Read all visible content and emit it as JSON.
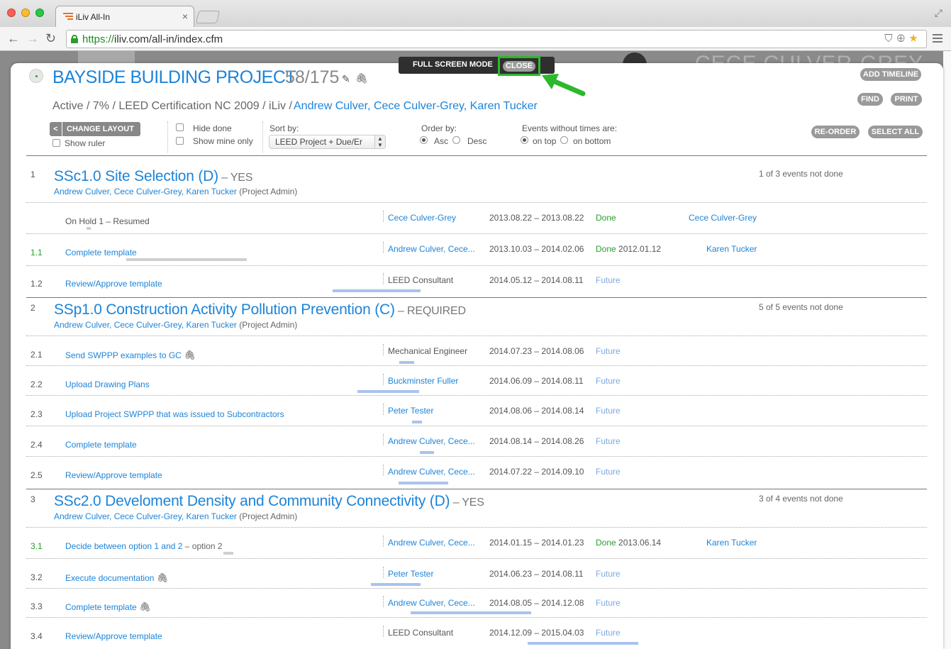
{
  "browser": {
    "tab_title": "iLiv All-In",
    "url_scheme": "https://",
    "url_host": "iliv.com",
    "url_path": "/all-in/index.cfm"
  },
  "background": {
    "header_text": "CECE CULVER-GREY"
  },
  "fullscreen": {
    "label": "FULL SCREEN MODE",
    "close_label": "CLOSE",
    "annotation_color": "#2db82d"
  },
  "project": {
    "title": "BAYSIDE BUILDING PROJECT",
    "count": "58/175",
    "status_line": "Active / 7% / LEED Certification NC 2009 / iLiv /",
    "people": "Andrew Culver, Cece Culver-Grey, Karen Tucker",
    "add_timeline": "ADD TIMELINE",
    "find": "FIND",
    "print": "PRINT"
  },
  "controls": {
    "change_layout_arrow": "<",
    "change_layout": "CHANGE LAYOUT",
    "show_ruler": "Show ruler",
    "hide_done": "Hide done",
    "show_mine_only": "Show mine only",
    "sort_by_label": "Sort by:",
    "sort_by_value": "LEED Project + Due/Er",
    "order_by_label": "Order by:",
    "asc": "Asc",
    "desc": "Desc",
    "events_label": "Events without times are:",
    "on_top": "on top",
    "on_bottom": "on bottom",
    "reorder": "RE-ORDER",
    "select_all": "SELECT ALL"
  },
  "sections": [
    {
      "num": "1",
      "title": "SSc1.0 Site Selection (D)",
      "suffix": " – YES",
      "people": "Andrew Culver, Cece Culver-Grey, Karen Tucker",
      "role": " (Project Admin)",
      "status": "1 of 3 events not done",
      "rows": [
        {
          "num": "",
          "name": "On Hold 1 – Resumed",
          "who": "Cece Culver-Grey",
          "dates": "2013.08.22 – 2013.08.22",
          "state": "Done",
          "done_date": "",
          "by": "Cece Culver-Grey"
        },
        {
          "num": "1.1",
          "name": "Complete template",
          "who": "Andrew Culver, Cece...",
          "dates": "2013.10.03 – 2014.02.06",
          "state": "Done",
          "done_date": " 2012.01.12",
          "by": "Karen Tucker"
        },
        {
          "num": "1.2",
          "name": "Review/Approve template",
          "who": "LEED Consultant",
          "dates": "2014.05.12 – 2014.08.11",
          "state": "Future",
          "done_date": "",
          "by": ""
        }
      ]
    },
    {
      "num": "2",
      "title": "SSp1.0 Construction Activity Pollution Prevention (C)",
      "suffix": " – REQUIRED",
      "people": "Andrew Culver, Cece Culver-Grey, Karen Tucker",
      "role": " (Project Admin)",
      "status": "5 of 5 events not done",
      "rows": [
        {
          "num": "2.1",
          "name": "Send SWPPP examples to GC",
          "who": "Mechanical Engineer",
          "dates": "2014.07.23 – 2014.08.06",
          "state": "Future"
        },
        {
          "num": "2.2",
          "name": "Upload Drawing Plans",
          "who": "Buckminster Fuller",
          "dates": "2014.06.09 – 2014.08.11",
          "state": "Future"
        },
        {
          "num": "2.3",
          "name": "Upload Project SWPPP that was issued to Subcontractors",
          "who": "Peter Tester",
          "dates": "2014.08.06 – 2014.08.14",
          "state": "Future"
        },
        {
          "num": "2.4",
          "name": "Complete template",
          "who": "Andrew Culver, Cece...",
          "dates": "2014.08.14 – 2014.08.26",
          "state": "Future"
        },
        {
          "num": "2.5",
          "name": "Review/Approve template",
          "who": "Andrew Culver, Cece...",
          "dates": "2014.07.22 – 2014.09.10",
          "state": "Future"
        }
      ]
    },
    {
      "num": "3",
      "title": "SSc2.0 Develoment Density and Community Connectivity (D)",
      "suffix": " – YES",
      "people": "Andrew Culver, Cece Culver-Grey, Karen Tucker",
      "role": " (Project Admin)",
      "status": "3 of 4 events not done",
      "rows": [
        {
          "num": "3.1",
          "name": "Decide between option 1 and 2",
          "extra": " – option 2",
          "who": "Andrew Culver, Cece...",
          "dates": "2014.01.15 – 2014.01.23",
          "state": "Done",
          "done_date": " 2013.06.14",
          "by": "Karen Tucker"
        },
        {
          "num": "3.2",
          "name": "Execute documentation",
          "who": "Peter Tester",
          "dates": "2014.06.23 – 2014.08.11",
          "state": "Future"
        },
        {
          "num": "3.3",
          "name": "Complete template",
          "who": "Andrew Culver, Cece...",
          "dates": "2014.08.05 – 2014.12.08",
          "state": "Future"
        },
        {
          "num": "3.4",
          "name": "Review/Approve template",
          "who": "LEED Consultant",
          "dates": "2014.12.09 – 2015.04.03",
          "state": "Future"
        }
      ]
    }
  ]
}
